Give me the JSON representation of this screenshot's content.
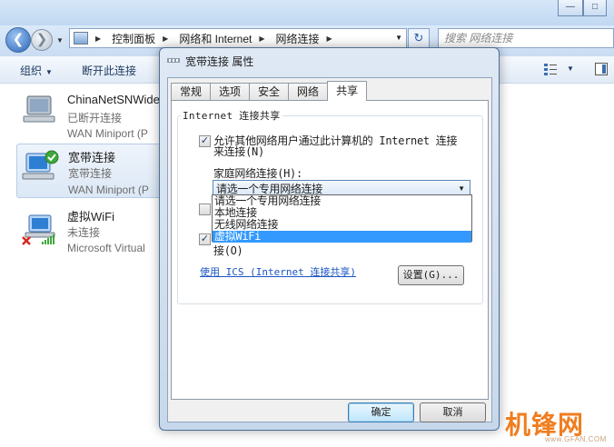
{
  "address_bar": {
    "crumbs": [
      "控制面板",
      "网络和 Internet",
      "网络连接"
    ],
    "search_placeholder": "搜索 网络连接"
  },
  "toolbar": {
    "organize": "组织",
    "disconnect": "断开此连接"
  },
  "connections": [
    {
      "name": "ChinaNetSNWide",
      "status": "已断开连接",
      "device": "WAN Miniport (P"
    },
    {
      "name": "宽带连接",
      "status": "宽带连接",
      "device": "WAN Miniport (P"
    },
    {
      "name": "虚拟WiFi",
      "status": "未连接",
      "device": "Microsoft Virtual"
    }
  ],
  "dialog": {
    "title": "宽带连接 属性",
    "tabs": [
      "常规",
      "选项",
      "安全",
      "网络",
      "共享"
    ],
    "active_tab": "共享",
    "group_label": "Internet 连接共享",
    "allow_share_line1": "允许其他网络用户通过此计算机的 Internet 连接",
    "allow_share_line2": "来连接(N)",
    "home_network_label": "家庭网络连接(H):",
    "selected_value": "请选一个专用网络连接",
    "options": [
      "请选一个专用网络连接",
      "本地连接",
      "无线网络连接",
      "虚拟WiFi"
    ],
    "highlighted_option": "虚拟WiFi",
    "allow_control_tail": "接(O)",
    "ics_link": "使用 ICS (Internet 连接共享)",
    "settings_button": "设置(G)...",
    "ok_button": "确定",
    "cancel_button": "取消"
  },
  "watermark": {
    "brand": "机锋网",
    "site": "www.GFAN.COM"
  },
  "colors": {
    "accent": "#3399ff",
    "link": "#1a55c4",
    "watermark": "#f07d1e"
  }
}
